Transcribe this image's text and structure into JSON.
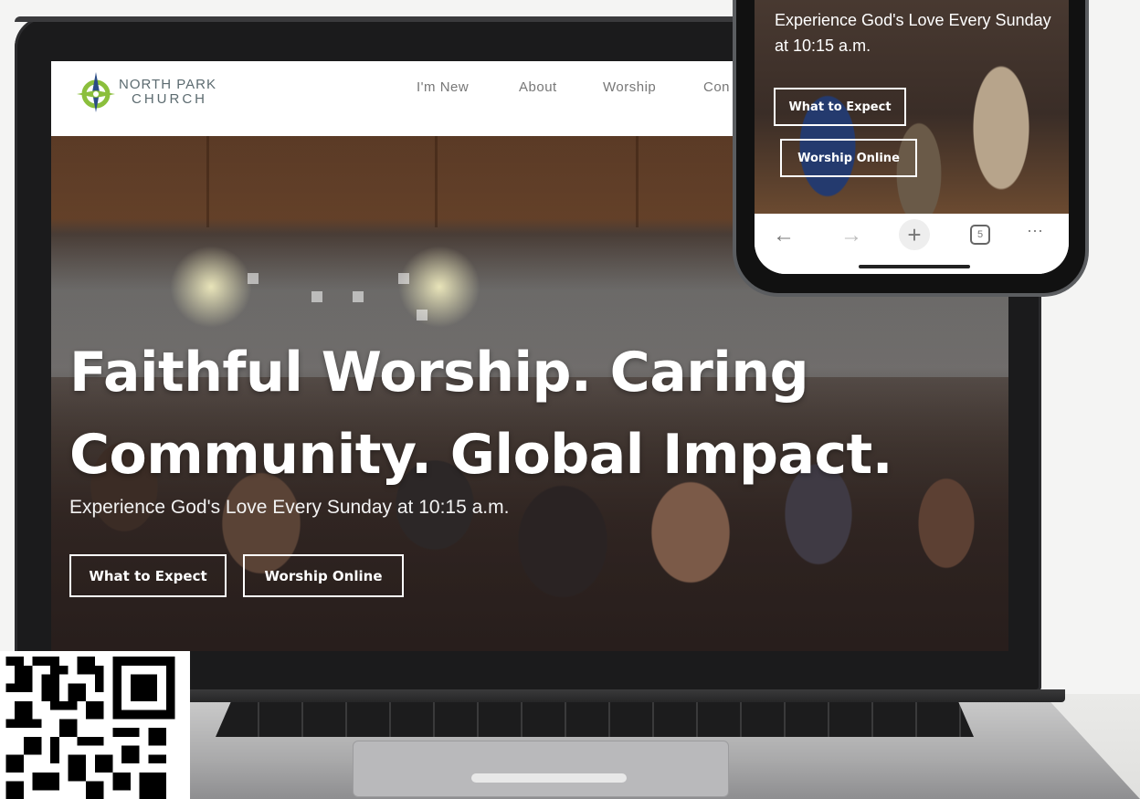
{
  "laptop": {
    "logo": {
      "line1": "NORTH PARK",
      "line2": "CHURCH"
    },
    "nav": [
      "I'm New",
      "About",
      "Worship",
      "Con"
    ],
    "hero": {
      "title": "Faithful Worship. Caring Community. Global Impact.",
      "subtitle": "Experience God's Love Every Sunday at 10:15 a.m.",
      "btn_expect": "What to Expect",
      "btn_online": "Worship Online"
    }
  },
  "phone": {
    "subtitle": "Experience God's Love Every Sunday at 10:15 a.m.",
    "btn_expect": "What to Expect",
    "btn_online": "Worship Online",
    "toolbar": {
      "back": "←",
      "forward": "→",
      "new_tab": "+",
      "tabs_count": "5",
      "more": "···"
    }
  },
  "colors": {
    "logo_green": "#8bbf3c",
    "logo_blue": "#2b4c86",
    "nav_text": "#777777"
  }
}
